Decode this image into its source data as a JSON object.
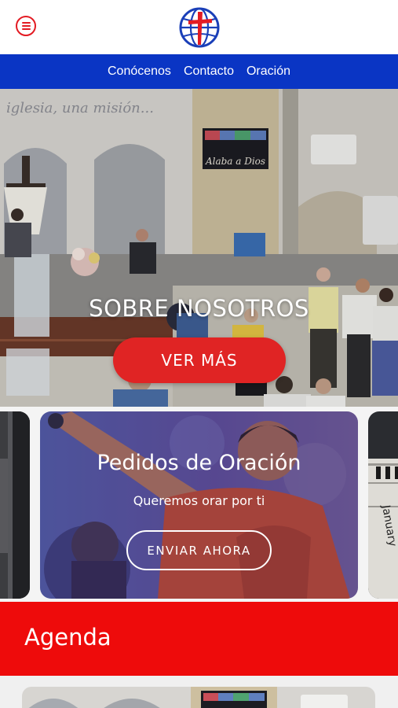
{
  "header": {
    "menu_icon": "hamburger-menu-icon",
    "logo_icon": "globe-cross-logo"
  },
  "nav": {
    "items": [
      {
        "label": "Conócenos"
      },
      {
        "label": "Contacto"
      },
      {
        "label": "Oración"
      }
    ]
  },
  "hero": {
    "title": "SOBRE NOSOTROS",
    "button_label": "VER MÁS",
    "wall_text": "iglesia, una misión...",
    "screen_line1": "Alaba a Dios",
    "slide_count": 2,
    "active_slide": 1
  },
  "prayer_card": {
    "title": "Pedidos de Oración",
    "subtitle": "Queremos orar por ti",
    "button_label": "ENVIAR AHORA"
  },
  "calendar_card": {
    "text": "January"
  },
  "agenda": {
    "title": "Agenda"
  },
  "colors": {
    "brand_red": "#e02424",
    "nav_blue": "#0a35c4",
    "agenda_red": "#ee0b0b"
  }
}
